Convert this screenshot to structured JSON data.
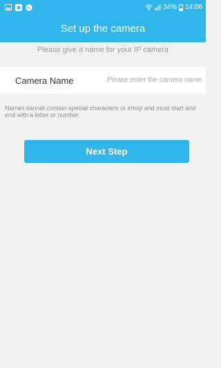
{
  "status_bar": {
    "icons": [
      "gallery-icon",
      "app-icon",
      "whatsapp-icon",
      "wifi-icon",
      "signal-icon",
      "battery-icon"
    ],
    "battery": "34%",
    "time": "14:06"
  },
  "header": {
    "title": "Set up the camera"
  },
  "form": {
    "subtitle": "Please give a name for your IP camera",
    "camera_name_label": "Camera Name",
    "camera_name_placeholder": "Please enter the camera name",
    "camera_name_value": "",
    "hint": "Names cannot contain special characters or emoji and must start and end with a letter or number.",
    "next_label": "Next Step"
  },
  "colors": {
    "accent": "#2fb5ea",
    "background": "#f2f2f2",
    "row_background": "#ffffff",
    "hint_text": "#8e8e8e"
  }
}
